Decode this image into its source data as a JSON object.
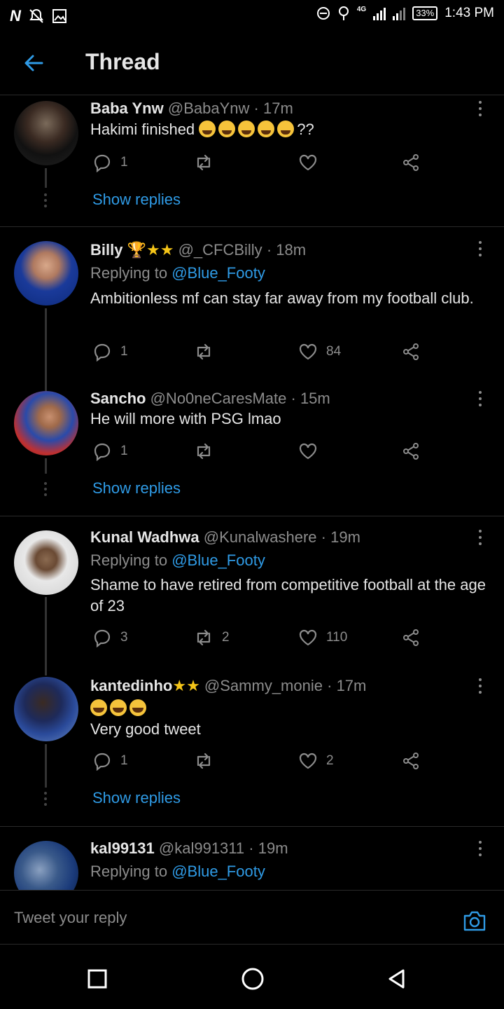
{
  "status_bar": {
    "time": "1:43 PM",
    "battery": "33%",
    "network": "4G",
    "icons": [
      "n-app-icon",
      "notification-off-icon",
      "image-icon",
      "do-not-disturb-icon",
      "alarm-icon",
      "signal-icon",
      "signal-icon"
    ]
  },
  "app_bar": {
    "title": "Thread",
    "back_icon": "arrow-left-icon"
  },
  "tweets": [
    {
      "name": "Baba Ynw",
      "handle": "@BabaYnw",
      "time": "17m",
      "text_prefix": "Hakimi finished ",
      "text_suffix": "??",
      "emoji": "loudly-crying-face",
      "emoji_count": 5,
      "replies": "1",
      "retweets": "",
      "likes": ""
    },
    {
      "name": "Billy",
      "name_badges": "🏆★★",
      "handle": "@_CFCBilly",
      "time": "18m",
      "replying_to_label": "Replying to",
      "replying_to": "@Blue_Footy",
      "text": "Ambitionless mf can stay far away from my football club.",
      "replies": "1",
      "retweets": "",
      "likes": "84"
    },
    {
      "name": "Sancho",
      "handle": "@No0neCaresMate",
      "time": "15m",
      "text": "He will more with PSG lmao",
      "replies": "1",
      "retweets": "",
      "likes": ""
    },
    {
      "name": "Kunal Wadhwa",
      "handle": "@Kunalwashere",
      "time": "19m",
      "replying_to_label": "Replying to",
      "replying_to": "@Blue_Footy",
      "text": "Shame to have retired from competitive football at the age of 23",
      "replies": "3",
      "retweets": "2",
      "likes": "110"
    },
    {
      "name": "kantedinho",
      "name_badges": "★★",
      "handle": "@Sammy_monie",
      "time": "17m",
      "emoji": "face-with-tears-of-joy",
      "emoji_count": 3,
      "text": "Very good tweet",
      "replies": "1",
      "retweets": "",
      "likes": "2"
    },
    {
      "name": "kal99131",
      "handle": "@kal991311",
      "time": "19m",
      "replying_to_label": "Replying to",
      "replying_to": "@Blue_Footy"
    }
  ],
  "show_replies_label": "Show replies",
  "reply_bar": {
    "placeholder": "Tweet your reply",
    "camera_icon": "camera-icon"
  },
  "nav_bar": {
    "icons": [
      "recents-square-icon",
      "home-circle-icon",
      "back-triangle-icon"
    ]
  },
  "colors": {
    "background": "#000000",
    "accent": "#2f9be6",
    "muted": "#8c8c8c",
    "text": "#e6e6e6"
  }
}
